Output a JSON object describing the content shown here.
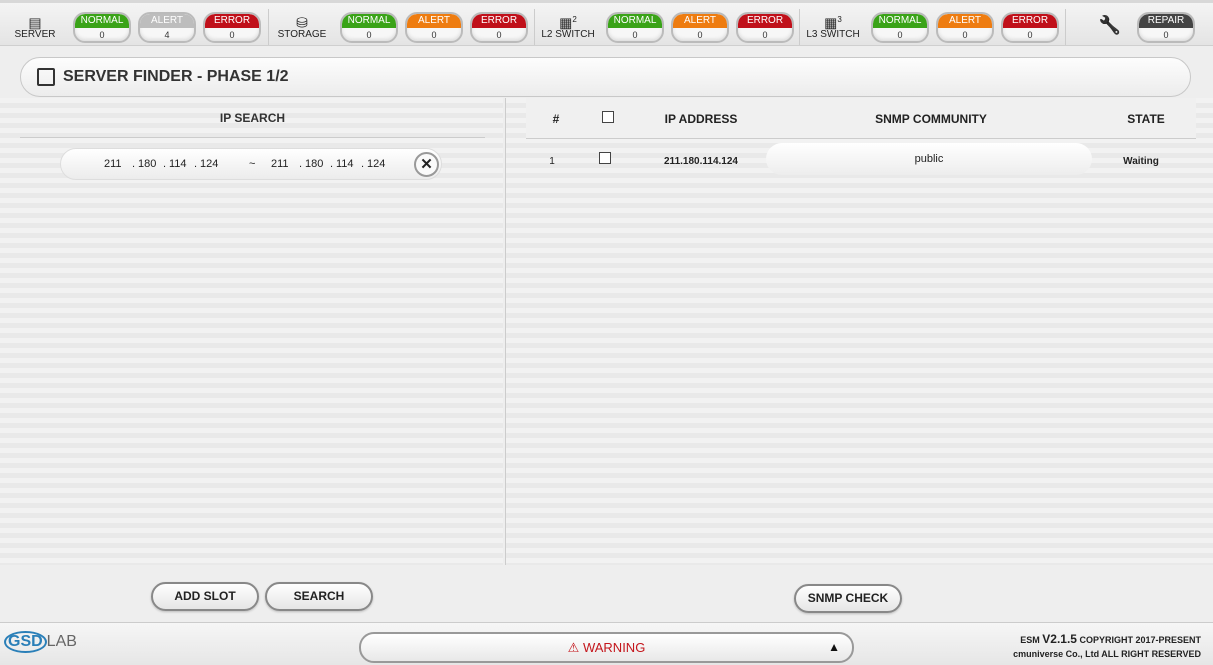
{
  "status_bar": {
    "devices": [
      {
        "name": "SERVER",
        "icon": "server-icon",
        "normal": "0",
        "alert": "4",
        "error": "0",
        "alert_active": false
      },
      {
        "name": "STORAGE",
        "icon": "database-icon",
        "normal": "0",
        "alert": "0",
        "error": "0",
        "alert_active": true
      },
      {
        "name": "L2 SWITCH",
        "icon": "switch-l2-icon",
        "superscript": "2",
        "normal": "0",
        "alert": "0",
        "error": "0",
        "alert_active": true
      },
      {
        "name": "L3 SWITCH",
        "icon": "switch-l3-icon",
        "superscript": "3",
        "normal": "0",
        "alert": "0",
        "error": "0",
        "alert_active": true
      }
    ],
    "labels": {
      "normal": "NORMAL",
      "alert": "ALERT",
      "error": "ERROR",
      "repair": "REPAIR"
    },
    "repair_count": "0",
    "colors": {
      "normal": "#3aa318",
      "alert": "#ee7c10",
      "alert_inactive": "#bdbdbd",
      "error": "#c0101a",
      "repair": "#444444"
    }
  },
  "title": "SERVER FINDER - PHASE 1/2",
  "ip_search": {
    "heading": "IP SEARCH",
    "ranges": [
      {
        "start": [
          "211",
          "180",
          "114",
          "124"
        ],
        "end": [
          "211",
          "180",
          "114",
          "124"
        ],
        "separator": "~"
      }
    ],
    "clear_symbol": "✕"
  },
  "table": {
    "columns": [
      "#",
      "",
      "IP ADDRESS",
      "SNMP COMMUNITY",
      "STATE"
    ],
    "rows": [
      {
        "index": "1",
        "ip": "211.180.114.124",
        "community": "public",
        "state": "Waiting"
      }
    ]
  },
  "buttons": {
    "add_slot": "ADD SLOT",
    "search": "SEARCH",
    "snmp_check": "SNMP CHECK"
  },
  "footer": {
    "logo": "GSDLAB",
    "warning": "WARNING",
    "version_prefix": "ESM ",
    "version": "V2.1.5",
    "copyright": " COPYRIGHT 2017-PRESENT",
    "company": "cmuniverse Co., Ltd ALL RIGHT RESERVED"
  }
}
